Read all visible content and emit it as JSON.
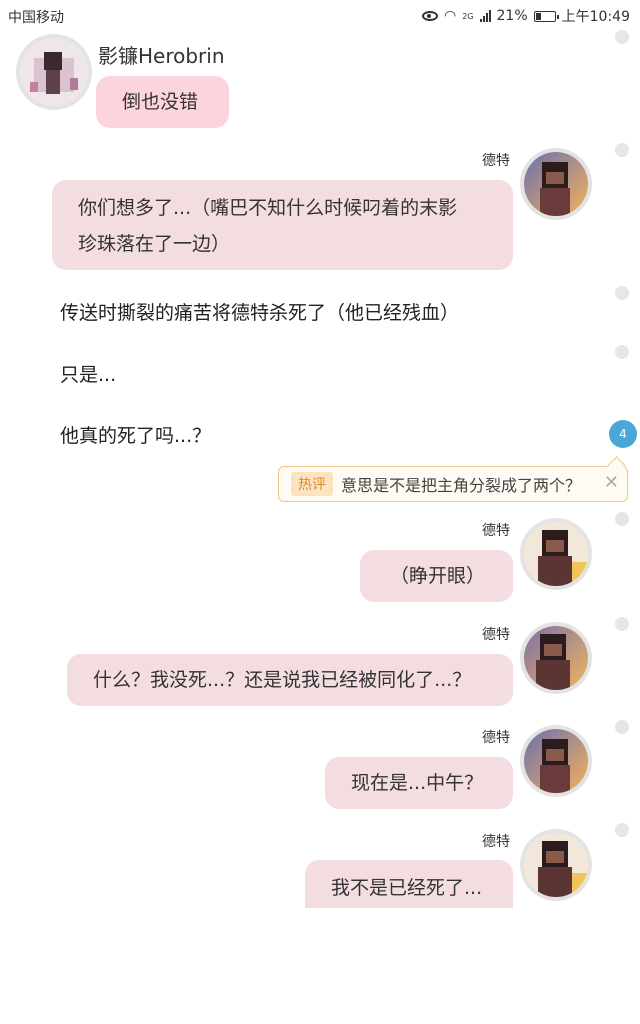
{
  "status_bar": {
    "carrier": "中国移动",
    "network": "2G",
    "battery": "21%",
    "time": "上午10:49"
  },
  "messages": [
    {
      "sender": "影镰Herobrin",
      "text": "倒也没错"
    },
    {
      "sender": "德特",
      "text_line1": "你们想多了...（嘴巴不知什么时候叼着的末影",
      "text_line2": "珍珠落在了一边）"
    },
    {
      "sender": "德特",
      "text": "（睁开眼）"
    },
    {
      "sender": "德特",
      "text": "什么？我没死...？还是说我已经被同化了...？"
    },
    {
      "sender": "德特",
      "text": "现在是...中午？"
    },
    {
      "sender": "德特",
      "text": "我不是已经死了..."
    }
  ],
  "narration": [
    "传送时撕裂的痛苦将德特杀死了（他已经残血）",
    "只是...",
    "他真的死了吗...？"
  ],
  "comment_badge": "4",
  "hot_comment": {
    "tag": "热评",
    "text": "意思是不是把主角分裂成了两个？",
    "close_icon": "close-icon"
  },
  "colors": {
    "own_bubble": "#fcd4dc",
    "other_bubble": "#f4dde1",
    "badge": "#4aa7d8",
    "hot_border": "#f3c48b"
  }
}
